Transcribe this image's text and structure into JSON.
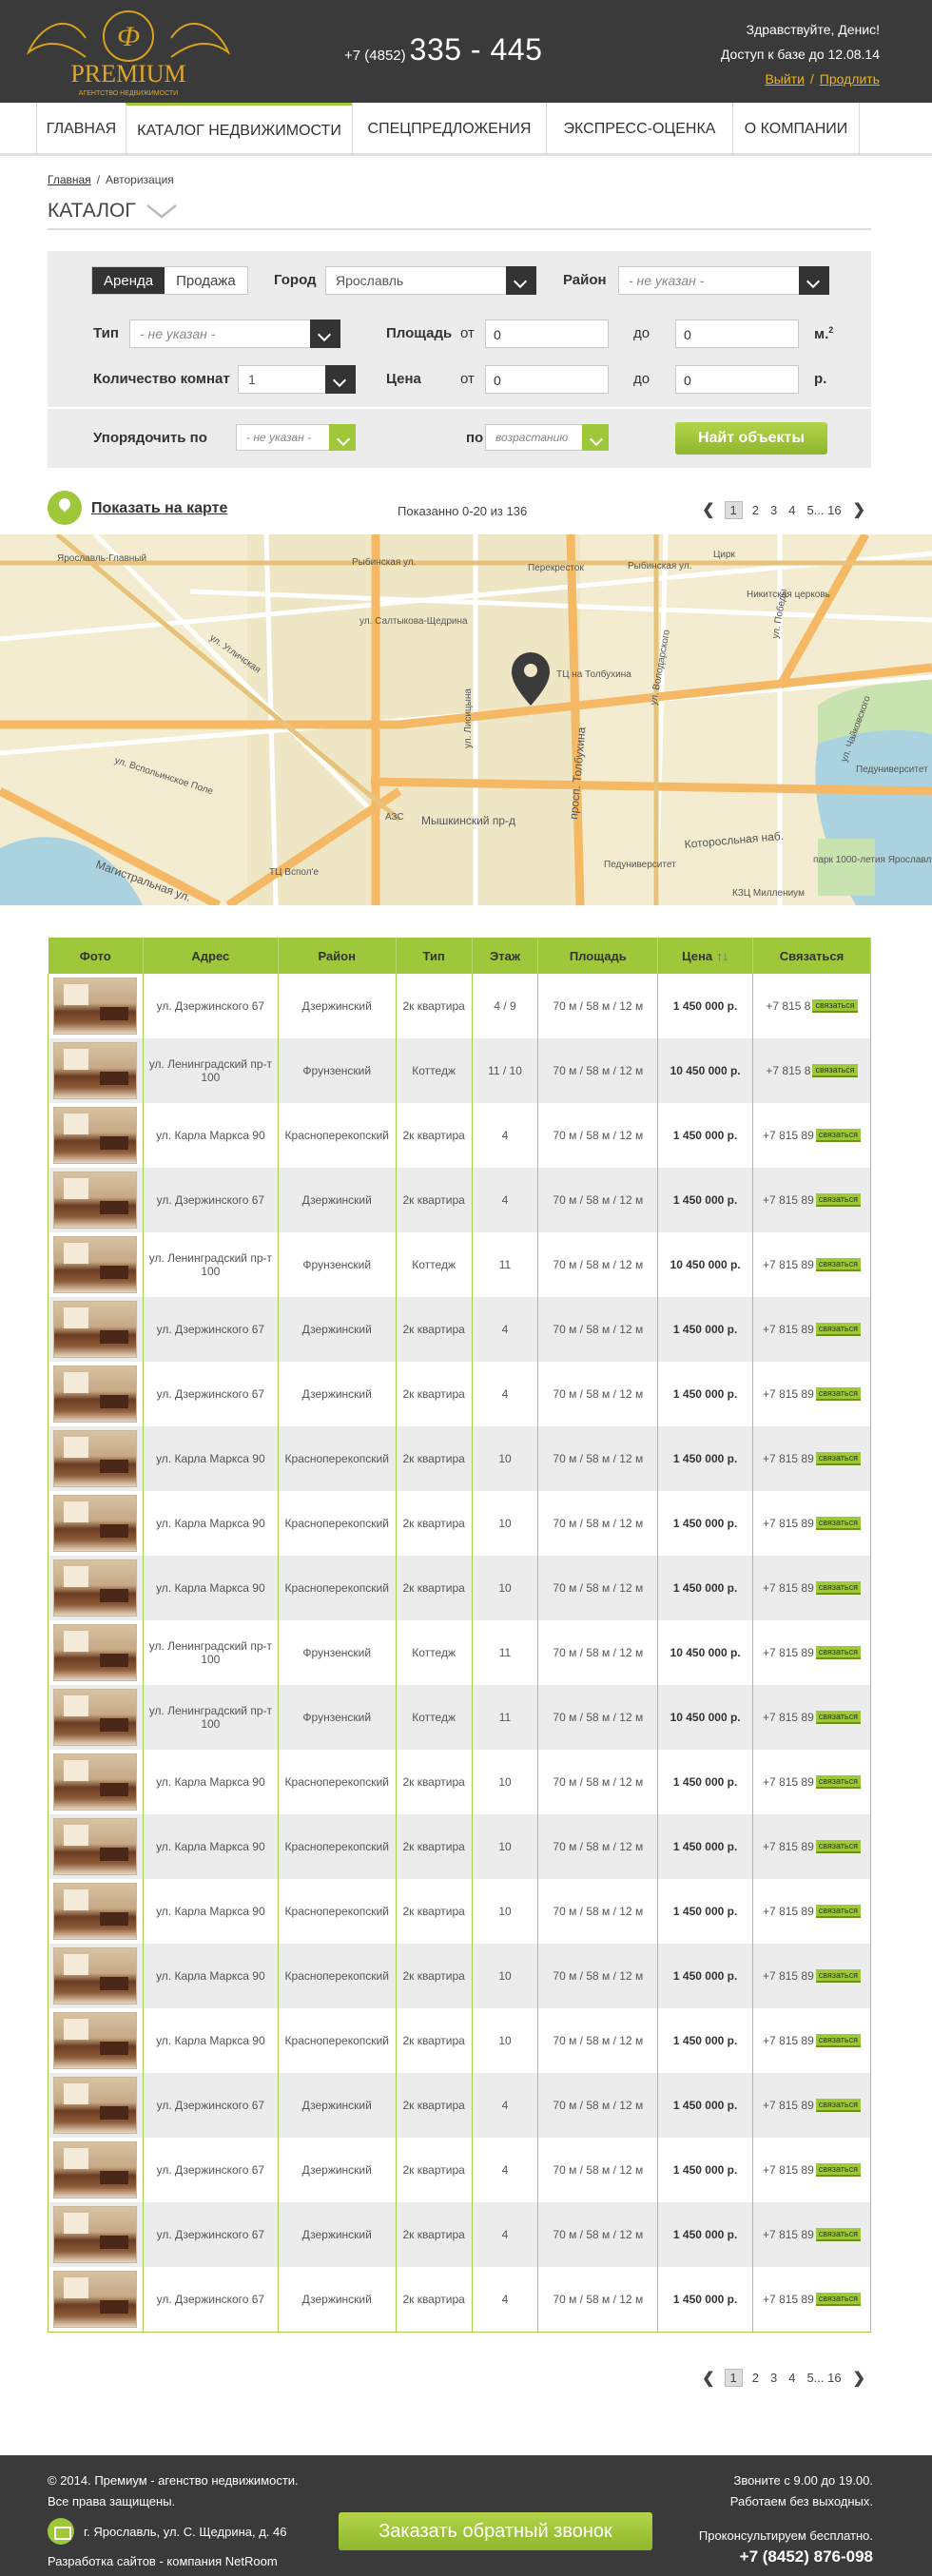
{
  "header": {
    "logo_text": "PREMIUM",
    "logo_sub": "АГЕНТСТВО НЕДВИЖИМОСТИ",
    "phone_code": "+7 (4852)",
    "phone_number": "335 - 445",
    "greeting": "Здравствуйте, Денис!",
    "access": "Доступ к базе до 12.08.14",
    "logout": "Выйти",
    "extend": "Продлить"
  },
  "nav": [
    "ГЛАВНАЯ",
    "КАТАЛОГ НЕДВИЖИМОСТИ",
    "СПЕЦПРЕДЛОЖЕНИЯ",
    "ЭКСПРЕСС-ОЦЕНКА",
    "О КОМПАНИИ"
  ],
  "breadcrumb": {
    "home": "Главная",
    "current": "Авторизация"
  },
  "catalog_title": "КАТАЛОГ",
  "filter": {
    "rent": "Аренда",
    "sale": "Продажа",
    "city_label": "Город",
    "city_value": "Ярославль",
    "district_label": "Район",
    "district_value": "- не указан -",
    "type_label": "Тип",
    "type_value": "- не указан -",
    "area_label": "Площадь",
    "from": "от",
    "to": "до",
    "area_from": "0",
    "area_to": "0",
    "area_unit": "м.",
    "area_unit_sup": "2",
    "rooms_label": "Количество комнат",
    "rooms_value": "1",
    "price_label": "Цена",
    "price_from": "0",
    "price_to": "0",
    "price_unit": "р.",
    "sort_label": "Упорядочить  по",
    "sort_value": "- не указан -",
    "by_label": "по",
    "order_value": "возрастанию",
    "find_button": "Найт объекты"
  },
  "mapbar": {
    "show_map": "Показать на карте",
    "shown": "Показанно 0-20 из 136"
  },
  "pager": {
    "prev": "❮",
    "pages": [
      "1",
      "2",
      "3",
      "4"
    ],
    "last": "5... 16",
    "next": "❯"
  },
  "map_labels": {
    "station": "Ярославль-Главный",
    "rybinskaya1": "Рыбинская ул.",
    "rybinskaya2": "Рыбинская ул.",
    "perekrestok": "Перекресток",
    "circus": "Цирк",
    "church": "Никитская церковь",
    "saltykova": "ул. Салтыкова-Щедрина",
    "tolbukhina_tc": "ТЦ на Толбухина",
    "lisitsyna": "ул. Лисицына",
    "tolbukhina_pr": "просп. Толбухина",
    "vspolinskoe": "ул. Вспольинское Поле",
    "ugl": "ул. Угличская",
    "azs": "АЗС",
    "myshkinsky": "Мышкинский пр-д",
    "vspolye": "ТЦ Вспол'е",
    "magistral": "Магистральная ул.",
    "peduniver": "Педуниверситет",
    "peduniver2": "Педуниверситет",
    "kotorosl": "Которосльная наб.",
    "park": "парк 1000-летия Ярославля",
    "kzts": "КЗЦ Миллениум",
    "vosstaniya": "ул. Победы",
    "chaykovskogo": "ул. Чайковского",
    "volodarskogo": "ул. Володарского"
  },
  "table": {
    "headers": [
      "Фото",
      "Адрес",
      "Район",
      "Тип",
      "Этаж",
      "Площадь",
      "Цена",
      "Связаться"
    ],
    "sort_icon": "↑↓",
    "contact_button": "связаться",
    "rows": [
      {
        "addr": "ул. Дзержинского 67",
        "district": "Дзержинский",
        "type": "2к квартира",
        "floor": "4 / 9",
        "area": "70 м / 58 м / 12 м",
        "price": "1 450 000 р.",
        "phone": "+7 815 8"
      },
      {
        "addr": "ул. Ленинградский пр-т 100",
        "district": "Фрунзенский",
        "type": "Коттедж",
        "floor": "11 / 10",
        "area": "70 м / 58 м / 12 м",
        "price": "10 450 000 р.",
        "phone": "+7 815 8"
      },
      {
        "addr": "ул. Карла Маркса 90",
        "district": "Красноперекопский",
        "type": "2к квартира",
        "floor": "4",
        "area": "70 м / 58 м / 12 м",
        "price": "1 450 000 р.",
        "phone": "+7 815 89"
      },
      {
        "addr": "ул. Дзержинского 67",
        "district": "Дзержинский",
        "type": "2к квартира",
        "floor": "4",
        "area": "70 м / 58 м / 12 м",
        "price": "1 450 000 р.",
        "phone": "+7 815 89"
      },
      {
        "addr": "ул. Ленинградский пр-т 100",
        "district": "Фрунзенский",
        "type": "Коттедж",
        "floor": "11",
        "area": "70 м / 58 м / 12 м",
        "price": "10 450 000 р.",
        "phone": "+7 815 89"
      },
      {
        "addr": "ул. Дзержинского 67",
        "district": "Дзержинский",
        "type": "2к квартира",
        "floor": "4",
        "area": "70 м / 58 м / 12 м",
        "price": "1 450 000 р.",
        "phone": "+7 815 89"
      },
      {
        "addr": "ул. Дзержинского 67",
        "district": "Дзержинский",
        "type": "2к квартира",
        "floor": "4",
        "area": "70 м / 58 м / 12 м",
        "price": "1 450 000 р.",
        "phone": "+7 815 89"
      },
      {
        "addr": "ул. Карла Маркса 90",
        "district": "Красноперекопский",
        "type": "2к квартира",
        "floor": "10",
        "area": "70 м / 58 м / 12 м",
        "price": "1 450 000 р.",
        "phone": "+7 815 89"
      },
      {
        "addr": "ул. Карла Маркса 90",
        "district": "Красноперекопский",
        "type": "2к квартира",
        "floor": "10",
        "area": "70 м / 58 м / 12 м",
        "price": "1 450 000 р.",
        "phone": "+7 815 89"
      },
      {
        "addr": "ул. Карла Маркса 90",
        "district": "Красноперекопский",
        "type": "2к квартира",
        "floor": "10",
        "area": "70 м / 58 м / 12 м",
        "price": "1 450 000 р.",
        "phone": "+7 815 89"
      },
      {
        "addr": "ул. Ленинградский пр-т 100",
        "district": "Фрунзенский",
        "type": "Коттедж",
        "floor": "11",
        "area": "70 м / 58 м / 12 м",
        "price": "10 450 000 р.",
        "phone": "+7 815 89"
      },
      {
        "addr": "ул. Ленинградский пр-т 100",
        "district": "Фрунзенский",
        "type": "Коттедж",
        "floor": "11",
        "area": "70 м / 58 м / 12 м",
        "price": "10 450 000 р.",
        "phone": "+7 815 89"
      },
      {
        "addr": "ул. Карла Маркса 90",
        "district": "Красноперекопский",
        "type": "2к квартира",
        "floor": "10",
        "area": "70 м / 58 м / 12 м",
        "price": "1 450 000 р.",
        "phone": "+7 815 89"
      },
      {
        "addr": "ул. Карла Маркса 90",
        "district": "Красноперекопский",
        "type": "2к квартира",
        "floor": "10",
        "area": "70 м / 58 м / 12 м",
        "price": "1 450 000 р.",
        "phone": "+7 815 89"
      },
      {
        "addr": "ул. Карла Маркса 90",
        "district": "Красноперекопский",
        "type": "2к квартира",
        "floor": "10",
        "area": "70 м / 58 м / 12 м",
        "price": "1 450 000 р.",
        "phone": "+7 815 89"
      },
      {
        "addr": "ул. Карла Маркса 90",
        "district": "Красноперекопский",
        "type": "2к квартира",
        "floor": "10",
        "area": "70 м / 58 м / 12 м",
        "price": "1 450 000 р.",
        "phone": "+7 815 89"
      },
      {
        "addr": "ул. Карла Маркса 90",
        "district": "Красноперекопский",
        "type": "2к квартира",
        "floor": "10",
        "area": "70 м / 58 м / 12 м",
        "price": "1 450 000 р.",
        "phone": "+7 815 89"
      },
      {
        "addr": "ул. Дзержинского 67",
        "district": "Дзержинский",
        "type": "2к квартира",
        "floor": "4",
        "area": "70 м / 58 м / 12 м",
        "price": "1 450 000 р.",
        "phone": "+7 815 89"
      },
      {
        "addr": "ул. Дзержинского 67",
        "district": "Дзержинский",
        "type": "2к квартира",
        "floor": "4",
        "area": "70 м / 58 м / 12 м",
        "price": "1 450 000 р.",
        "phone": "+7 815 89"
      },
      {
        "addr": "ул. Дзержинского 67",
        "district": "Дзержинский",
        "type": "2к квартира",
        "floor": "4",
        "area": "70 м / 58 м / 12 м",
        "price": "1 450 000 р.",
        "phone": "+7 815 89"
      },
      {
        "addr": "ул. Дзержинского 67",
        "district": "Дзержинский",
        "type": "2к квартира",
        "floor": "4",
        "area": "70 м / 58 м / 12 м",
        "price": "1 450 000 р.",
        "phone": "+7 815 89"
      }
    ]
  },
  "footer": {
    "copyright": "© 2014. Премиум - агенство недвижимости.",
    "rights": "Все права защищены.",
    "address": "г. Ярославль, ул. С. Щедрина, д. 46",
    "developer": "Разработка сайтов - компания NetRoom",
    "callback": "Заказать обратный звонок",
    "hours": "Звоните с 9.00 до 19.00.",
    "weekends": "Работаем без выходных.",
    "consult": "Проконсультируем бесплатно.",
    "phone": "+7 (8452) 876-098"
  },
  "colors": {
    "accent": "#9fc73a",
    "dark": "#3a3a3a",
    "gold": "#f0b400"
  }
}
